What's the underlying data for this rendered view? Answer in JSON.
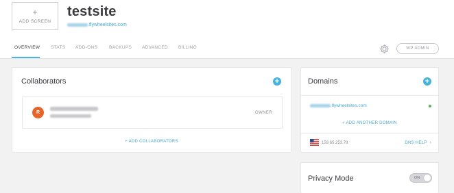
{
  "header": {
    "add_screen_plus": "+",
    "add_screen_label": "ADD SCREEN",
    "site_title": "testsite",
    "site_url_suffix": ".flywheelsites.com",
    "wp_admin_label": "WP ADMIN",
    "gear_icon": "gear-icon"
  },
  "tabs": [
    {
      "label": "OVERVIEW",
      "active": true
    },
    {
      "label": "STATS"
    },
    {
      "label": "ADD-ONS"
    },
    {
      "label": "BACKUPS"
    },
    {
      "label": "ADVANCED"
    },
    {
      "label": "BILLING"
    }
  ],
  "collaborators": {
    "title": "Collaborators",
    "add_icon": "+",
    "rows": [
      {
        "avatar_initial": "R",
        "role": "OWNER"
      }
    ],
    "add_link": "+ ADD COLLABORATORS"
  },
  "domains": {
    "title": "Domains",
    "add_icon": "+",
    "domain_suffix": ".flywheelsites.com",
    "add_link": "+ ADD ANOTHER DOMAIN",
    "ip": "159.65.253.78",
    "dns_help": "DNS HELP",
    "dns_help_chevron": "›"
  },
  "privacy": {
    "title": "Privacy Mode",
    "toggle_label": "ON"
  },
  "colors": {
    "accent": "#47b2da",
    "avatar": "#e8652a",
    "status_ok": "#4bb85a"
  }
}
